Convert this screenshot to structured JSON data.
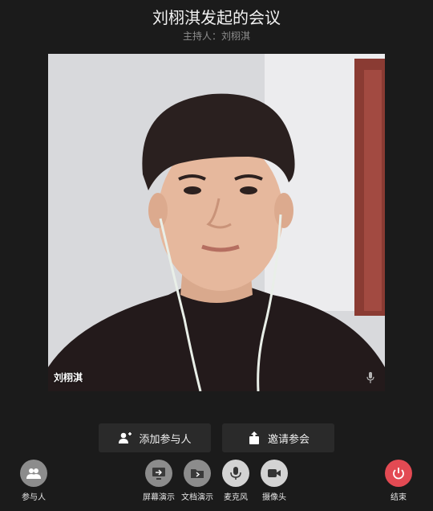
{
  "meeting": {
    "title": "刘栩淇发起的会议",
    "host_line": "主持人：刘栩淇"
  },
  "video": {
    "participant_name": "刘栩淇",
    "mic_icon": "mic-icon"
  },
  "actions": {
    "add_participant": "添加参与人",
    "invite": "邀请参会"
  },
  "controls": [
    {
      "label": "参与人",
      "icon": "participants-icon"
    },
    {
      "label": "屏幕演示",
      "icon": "screen-share-icon"
    },
    {
      "label": "文档演示",
      "icon": "document-share-icon"
    },
    {
      "label": "麦克风",
      "icon": "microphone-icon"
    },
    {
      "label": "摄像头",
      "icon": "camera-icon"
    },
    {
      "label": "结束",
      "icon": "power-icon"
    }
  ],
  "colors": {
    "background": "#1b1b1b",
    "end_button": "#e34a53",
    "control_circle": "#d3d3d3"
  }
}
